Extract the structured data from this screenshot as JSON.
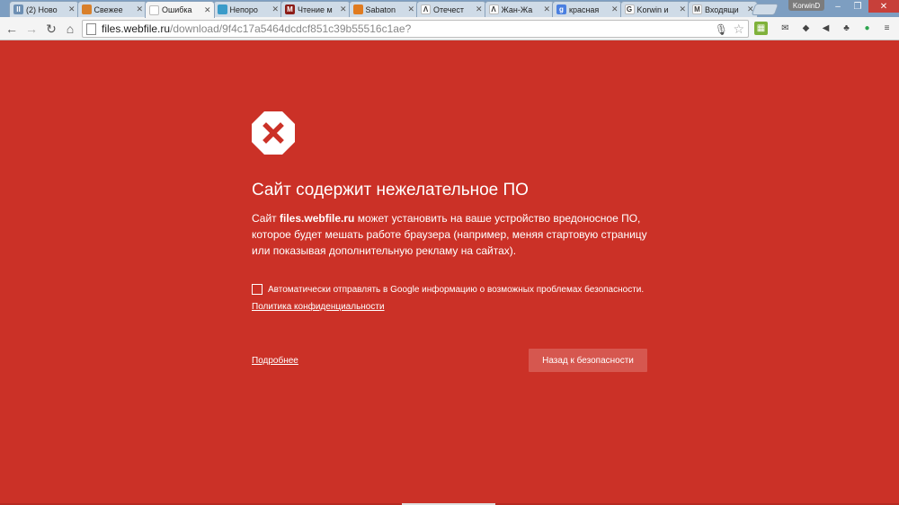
{
  "tabs": [
    {
      "title": "(2) Ново",
      "favicon": "pause-icon",
      "color": "#6d8fb3",
      "glyph": "II",
      "active": false
    },
    {
      "title": "Свежее",
      "favicon": "orange-icon",
      "color": "#d9802b",
      "glyph": "",
      "active": false
    },
    {
      "title": "Ошибка",
      "favicon": "page-icon",
      "color": "#ffffff",
      "glyph": "",
      "active": true
    },
    {
      "title": "Непоро",
      "favicon": "monitor-icon",
      "color": "#3a9bc9",
      "glyph": "",
      "active": false
    },
    {
      "title": "Чтение м",
      "favicon": "m-icon",
      "color": "#8c1d18",
      "glyph": "M",
      "active": false
    },
    {
      "title": "Sabaton",
      "favicon": "headphones-icon",
      "color": "#e07b20",
      "glyph": "",
      "active": false
    },
    {
      "title": "Отечест",
      "favicon": "lambda-icon",
      "color": "#ffffff",
      "glyph": "Λ",
      "active": false
    },
    {
      "title": "Жан-Жа",
      "favicon": "lambda-icon",
      "color": "#ffffff",
      "glyph": "Λ",
      "active": false
    },
    {
      "title": "красная",
      "favicon": "google-icon",
      "color": "#4a7fe0",
      "glyph": "g",
      "active": false
    },
    {
      "title": "Korwin и",
      "favicon": "google-q-icon",
      "color": "#ffffff",
      "glyph": "G",
      "active": false
    },
    {
      "title": "Входящи",
      "favicon": "gmail-icon",
      "color": "#ffffff",
      "glyph": "M",
      "active": false
    }
  ],
  "profile_name": "KorwinD",
  "window_controls": {
    "minimize": "–",
    "maximize": "❐",
    "close": "✕"
  },
  "nav": {
    "back": "←",
    "forward": "→",
    "reload": "↻",
    "home": "⌂"
  },
  "address": {
    "host": "files.webfile.ru",
    "path": "/download/9f4c17a5464dcdcf851c39b55516c1ae?"
  },
  "extensions": [
    {
      "name": "colorful-ext-icon",
      "color": "#7fb13a",
      "glyph": "▦"
    },
    {
      "name": "envelope-ext-icon",
      "color": "#ffffff",
      "glyph": "✉"
    },
    {
      "name": "evernote-ext-icon",
      "color": "#ffffff",
      "glyph": "◆"
    },
    {
      "name": "speaker-ext-icon",
      "color": "#ffffff",
      "glyph": "◀"
    },
    {
      "name": "leaf-ext-icon",
      "color": "#ffffff",
      "glyph": "♣"
    },
    {
      "name": "green-circle-ext-icon",
      "color": "#2da44e",
      "glyph": "●"
    },
    {
      "name": "menu-icon",
      "color": "#ffffff",
      "glyph": "≡"
    }
  ],
  "interstitial": {
    "heading": "Сайт содержит нежелательное ПО",
    "explanation_prefix": "Сайт ",
    "explanation_host": "files.webfile.ru",
    "explanation_suffix": " может установить на ваше устройство вредоносное ПО, которое будет мешать работе браузера (например, меняя стартовую страницу или показывая дополнительную рекламу на сайтах).",
    "optin_label": "Автоматически отправлять в Google информацию о возможных проблемах безопасности.",
    "privacy_link": "Политика конфиденциальности",
    "details_link": "Подробнее",
    "back_button": "Назад к безопасности",
    "background_color": "#cb3127"
  }
}
